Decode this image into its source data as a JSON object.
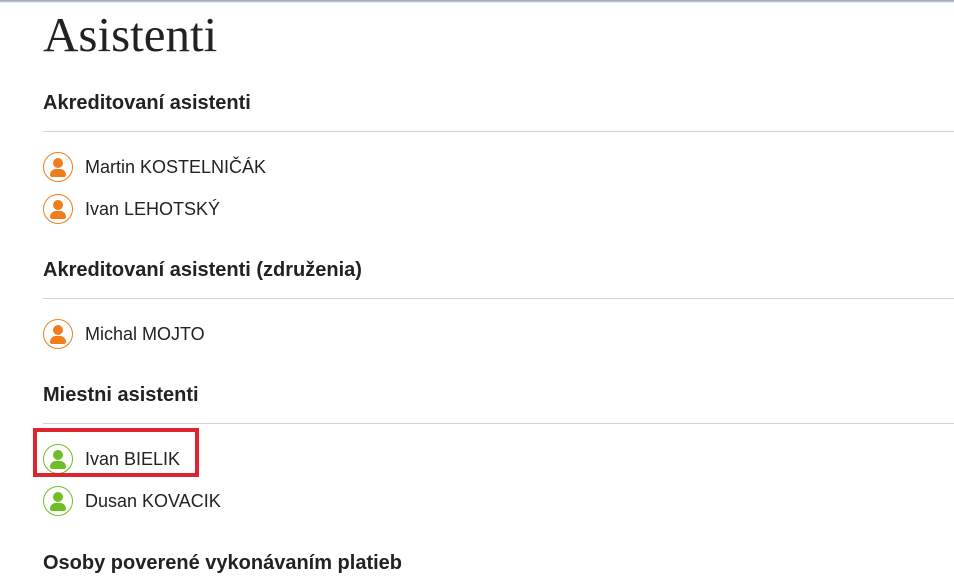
{
  "page": {
    "title": "Asistenti"
  },
  "sections": [
    {
      "heading": "Akreditovaní asistenti",
      "people": [
        {
          "name": "Martin KOSTELNIČÁK",
          "icon": "person-icon",
          "color": "#f07d1c"
        },
        {
          "name": "Ivan LEHOTSKÝ",
          "icon": "person-icon",
          "color": "#f07d1c"
        }
      ]
    },
    {
      "heading": "Akreditovaní asistenti (združenia)",
      "people": [
        {
          "name": "Michal MOJTO",
          "icon": "person-icon",
          "color": "#f07d1c"
        }
      ]
    },
    {
      "heading": "Miestni asistenti",
      "people": [
        {
          "name": "Ivan BIELIK",
          "icon": "person-icon",
          "color": "#6cbf24",
          "highlighted": true
        },
        {
          "name": "Dusan KOVACIK",
          "icon": "person-icon",
          "color": "#6cbf24"
        }
      ]
    },
    {
      "heading": "Osoby poverené vykonávaním platieb",
      "people": []
    }
  ],
  "colors": {
    "accredited_icon": "#f07d1c",
    "local_icon": "#6cbf24",
    "highlight_border": "#e0242f"
  }
}
